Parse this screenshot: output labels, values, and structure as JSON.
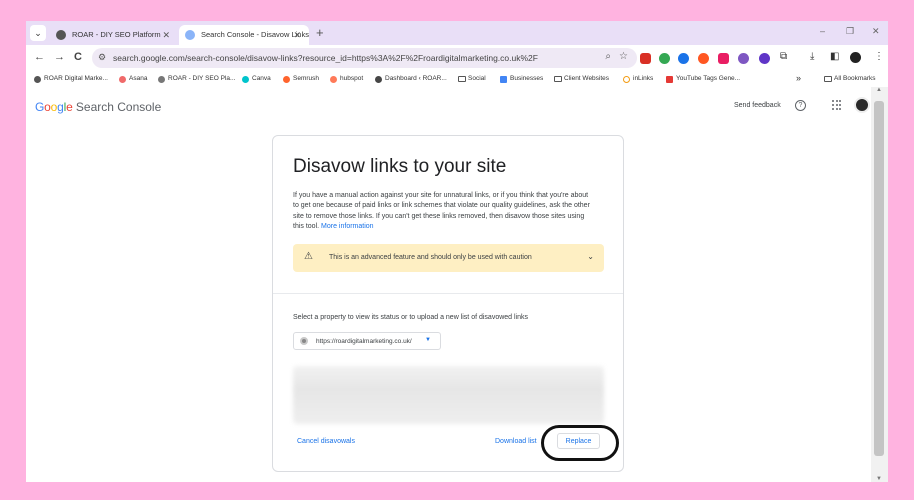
{
  "browser": {
    "tabs": [
      {
        "label": "ROAR - DIY SEO Platform",
        "active": false
      },
      {
        "label": "Search Console - Disavow Links",
        "active": true
      }
    ],
    "new_tab": "+",
    "window_controls": {
      "minimize": "–",
      "restore": "❐",
      "close": "✕"
    },
    "nav": {
      "back": "←",
      "forward": "→",
      "reload": "C"
    },
    "url": "search.google.com/search-console/disavow-links?resource_id=https%3A%2F%2Froardigitalmarketing.co.uk%2F",
    "bookmarks": [
      {
        "label": "ROAR Digital Marke..."
      },
      {
        "label": "Asana"
      },
      {
        "label": "ROAR - DIY SEO Pla..."
      },
      {
        "label": "Canva"
      },
      {
        "label": "Semrush"
      },
      {
        "label": "hubspot"
      },
      {
        "label": "Dashboard ‹ ROAR..."
      },
      {
        "label": "Social"
      },
      {
        "label": "Businesses"
      },
      {
        "label": "Client Websites"
      },
      {
        "label": "inLinks"
      },
      {
        "label": "YouTube Tags Gene..."
      }
    ],
    "bookmarks_overflow": "»",
    "all_bookmarks": "All Bookmarks"
  },
  "header": {
    "logo_brand": "Google",
    "logo_product": "Search Console",
    "send_feedback": "Send feedback",
    "help": "?"
  },
  "card": {
    "title": "Disavow links to your site",
    "description": "If you have a manual action against your site for unnatural links, or if you think that you're about to get one because of paid links or link schemes that violate our quality guidelines, ask the other site to remove those links. If you can't get these links removed, then disavow those sites using this tool.",
    "more_info": "More information",
    "warning": "This is an advanced feature and should only be used with caution",
    "select_label": "Select a property to view its status or to upload a new list of disavowed links",
    "property": "https://roardigitalmarketing.co.uk/",
    "cancel": "Cancel disavowals",
    "download": "Download list",
    "replace": "Replace"
  },
  "colors": {
    "background": "#ffb3e0",
    "link": "#1a73e8",
    "warning_bg": "#feefc3"
  }
}
